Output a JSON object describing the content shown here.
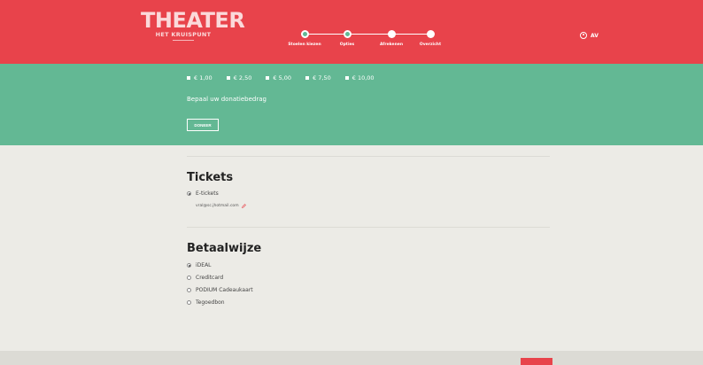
{
  "header": {
    "logo_main": "THEATER",
    "logo_sub": "HET KRUISPUNT",
    "steps": [
      {
        "label": "Stoelen kiezen",
        "state": "done"
      },
      {
        "label": "Opties",
        "state": "done"
      },
      {
        "label": "Afrekenen",
        "state": "current"
      },
      {
        "label": "Overzicht",
        "state": "todo"
      }
    ],
    "account_label": "AV",
    "account_icon": "user-circle-icon"
  },
  "donation": {
    "amounts": [
      "€ 1,00",
      "€ 2,50",
      "€ 5,00",
      "€ 7,50",
      "€ 10,00"
    ],
    "prompt": "Bepaal uw donatiebedrag",
    "button_label": "DONEER"
  },
  "tickets": {
    "title": "Tickets",
    "option": "E-tickets",
    "email": "vral@sc.jhotmail.com",
    "edit_icon": "pencil-icon"
  },
  "payment": {
    "title": "Betaalwijze",
    "options": [
      {
        "label": "iDEAL",
        "selected": true
      },
      {
        "label": "Creditcard",
        "selected": false
      },
      {
        "label": "PODIUM Cadeaukaart",
        "selected": false
      },
      {
        "label": "Tegoedbon",
        "selected": false
      }
    ]
  },
  "colors": {
    "header": "#e8434b",
    "donation": "#63b894",
    "background": "#ecebe6"
  }
}
